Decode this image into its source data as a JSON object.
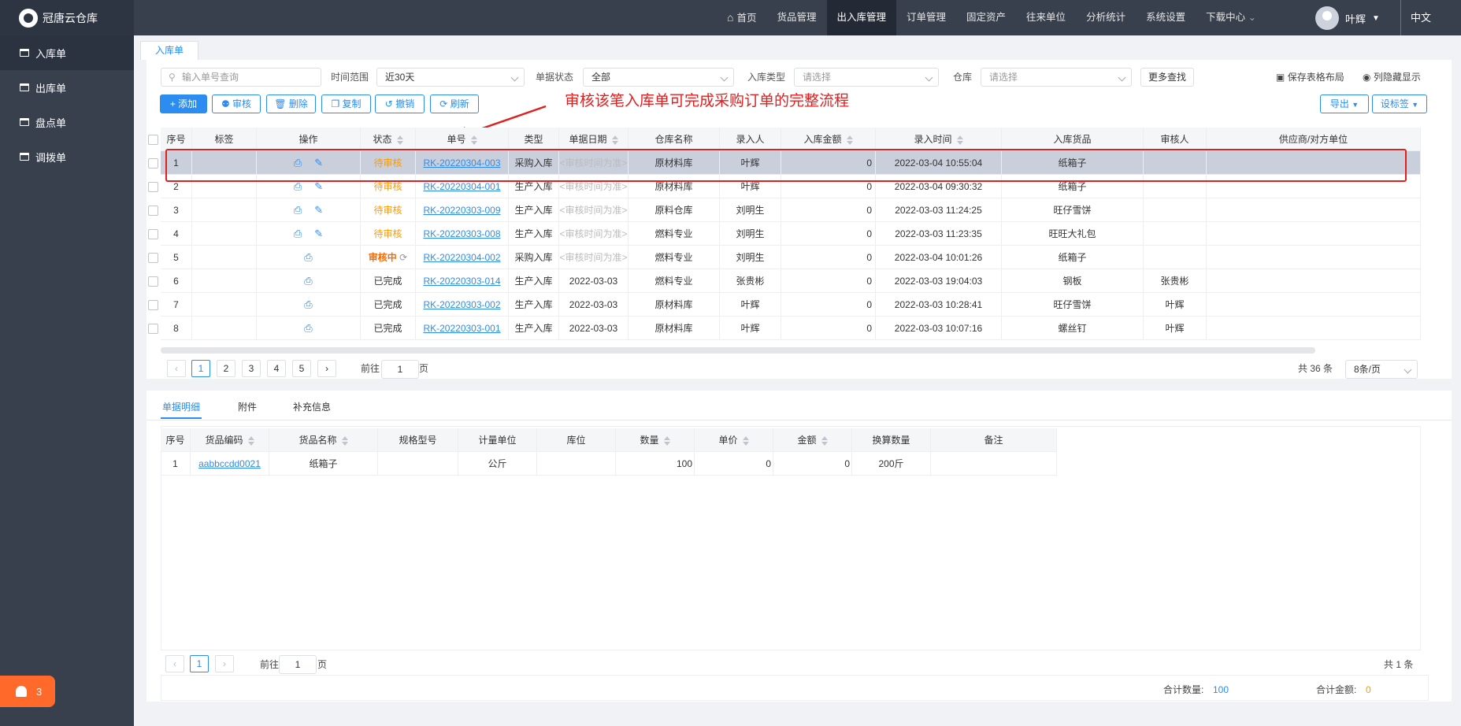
{
  "app": {
    "title": "冠唐云仓库"
  },
  "nav": {
    "items": [
      "首页",
      "货品管理",
      "出入库管理",
      "订单管理",
      "固定资产",
      "往来单位",
      "分析统计",
      "系统设置",
      "下载中心"
    ]
  },
  "user": {
    "name": "叶辉",
    "lang": "中文"
  },
  "sidebar": {
    "items": [
      "入库单",
      "出库单",
      "盘点单",
      "调拨单"
    ]
  },
  "badge": {
    "count": "3"
  },
  "page_tab": "入库单",
  "filters": {
    "search_placeholder": "输入单号查询",
    "time_label": "时间范围",
    "time_value": "近30天",
    "status_label": "单据状态",
    "status_value": "全部",
    "type_label": "入库类型",
    "type_placeholder": "请选择",
    "warehouse_label": "仓库",
    "warehouse_placeholder": "请选择",
    "more": "更多查找",
    "save_layout": "保存表格布局",
    "toggle_columns": "列隐藏显示"
  },
  "toolbar": {
    "add": "+ 添加",
    "audit": "审核",
    "delete": "删除",
    "copy": "复制",
    "revoke": "撤销",
    "refresh": "刷新",
    "export": "导出",
    "set_label": "设标签"
  },
  "annotation": "审核该笔入库单可完成采购订单的完整流程",
  "table": {
    "headers": [
      "序号",
      "标签",
      "操作",
      "状态",
      "单号",
      "类型",
      "单据日期",
      "仓库名称",
      "录入人",
      "入库金额",
      "录入时间",
      "入库货品",
      "审核人",
      "供应商/对方单位"
    ],
    "rows": [
      {
        "no": "1",
        "tag": "",
        "ops": "print,edit",
        "status": "待审核",
        "id": "RK-20220304-003",
        "type": "采购入库",
        "date": "<审核时间为准>",
        "warehouse": "原材料库",
        "creator": "叶辉",
        "amount": "0",
        "time": "2022-03-04 10:55:04",
        "goods": "纸箱子",
        "auditor": "",
        "supplier": ""
      },
      {
        "no": "2",
        "tag": "",
        "ops": "print,edit",
        "status": "待审核",
        "id": "RK-20220304-001",
        "type": "生产入库",
        "date": "<审核时间为准>",
        "warehouse": "原材料库",
        "creator": "叶辉",
        "amount": "0",
        "time": "2022-03-04 09:30:32",
        "goods": "纸箱子",
        "auditor": "",
        "supplier": ""
      },
      {
        "no": "3",
        "tag": "",
        "ops": "print,edit",
        "status": "待审核",
        "id": "RK-20220303-009",
        "type": "生产入库",
        "date": "<审核时间为准>",
        "warehouse": "原料仓库",
        "creator": "刘明生",
        "amount": "0",
        "time": "2022-03-03 11:24:25",
        "goods": "旺仔雪饼",
        "auditor": "",
        "supplier": ""
      },
      {
        "no": "4",
        "tag": "",
        "ops": "print,edit",
        "status": "待审核",
        "id": "RK-20220303-008",
        "type": "生产入库",
        "date": "<审核时间为准>",
        "warehouse": "燃料专业",
        "creator": "刘明生",
        "amount": "0",
        "time": "2022-03-03 11:23:35",
        "goods": "旺旺大礼包",
        "auditor": "",
        "supplier": ""
      },
      {
        "no": "5",
        "tag": "",
        "ops": "print",
        "status": "审核中",
        "id": "RK-20220304-002",
        "type": "采购入库",
        "date": "<审核时间为准>",
        "warehouse": "燃料专业",
        "creator": "刘明生",
        "amount": "0",
        "time": "2022-03-04 10:01:26",
        "goods": "纸箱子",
        "auditor": "",
        "supplier": ""
      },
      {
        "no": "6",
        "tag": "",
        "ops": "print",
        "status": "已完成",
        "id": "RK-20220303-014",
        "type": "生产入库",
        "date": "2022-03-03",
        "warehouse": "燃料专业",
        "creator": "张贵彬",
        "amount": "0",
        "time": "2022-03-03 19:04:03",
        "goods": "钢板",
        "auditor": "张贵彬",
        "supplier": ""
      },
      {
        "no": "7",
        "tag": "",
        "ops": "print",
        "status": "已完成",
        "id": "RK-20220303-002",
        "type": "生产入库",
        "date": "2022-03-03",
        "warehouse": "原材料库",
        "creator": "叶辉",
        "amount": "0",
        "time": "2022-03-03 10:28:41",
        "goods": "旺仔雪饼",
        "auditor": "叶辉",
        "supplier": ""
      },
      {
        "no": "8",
        "tag": "",
        "ops": "print",
        "status": "已完成",
        "id": "RK-20220303-001",
        "type": "生产入库",
        "date": "2022-03-03",
        "warehouse": "原材料库",
        "creator": "叶辉",
        "amount": "0",
        "time": "2022-03-03 10:07:16",
        "goods": "螺丝钉",
        "auditor": "叶辉",
        "supplier": ""
      }
    ]
  },
  "pagination": {
    "pages": [
      "1",
      "2",
      "3",
      "4",
      "5"
    ],
    "goto_prefix": "前往",
    "goto_value": "1",
    "goto_suffix": "页",
    "total": "共 36 条",
    "page_size": "8条/页"
  },
  "detail": {
    "tabs": [
      "单据明细",
      "附件",
      "补充信息"
    ],
    "headers": [
      "序号",
      "货品编码",
      "货品名称",
      "规格型号",
      "计量单位",
      "库位",
      "数量",
      "单价",
      "金额",
      "换算数量",
      "备注"
    ],
    "rows": [
      {
        "no": "1",
        "code": "aabbccdd0021",
        "name": "纸箱子",
        "spec": "",
        "unit": "公斤",
        "loc": "",
        "qty": "100",
        "price": "0",
        "amount": "0",
        "conv": "200斤",
        "remark": ""
      }
    ],
    "pagination": {
      "page": "1",
      "goto_prefix": "前往",
      "goto_value": "1",
      "goto_suffix": "页",
      "total": "共 1 条"
    },
    "summary": {
      "qty_label": "合计数量:",
      "qty_value": "100",
      "amount_label": "合计金额:",
      "amount_value": "0"
    }
  }
}
